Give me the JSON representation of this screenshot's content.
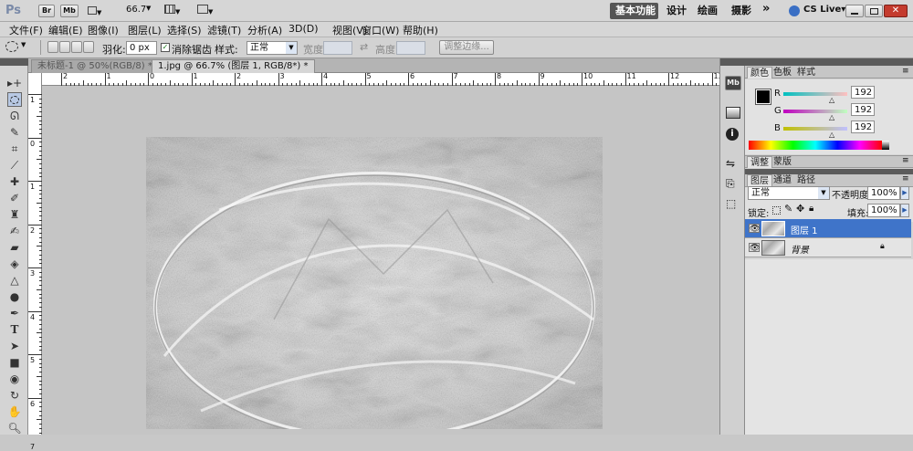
{
  "app": {
    "logo": "Ps",
    "badge_br": "Br",
    "badge_mb": "Mb",
    "zoom": "66.7"
  },
  "workspace": {
    "essentials": "基本功能",
    "design": "设计",
    "painting": "绘画",
    "photography": "摄影",
    "more": "»",
    "cslive": "CS Live▾"
  },
  "menus": [
    "文件(F)",
    "编辑(E)",
    "图像(I)",
    "图层(L)",
    "选择(S)",
    "滤镜(T)",
    "分析(A)",
    "3D(D)",
    "视图(V)",
    "窗口(W)",
    "帮助(H)"
  ],
  "options": {
    "feather_label": "羽化:",
    "feather_value": "0 px",
    "antialias": "消除锯齿",
    "style_label": "样式:",
    "style_value": "正常",
    "width_label": "宽度:",
    "height_label": "高度:",
    "refine": "调整边缘..."
  },
  "doc_tabs": [
    "未标题-1 @ 50%(RGB/8) *",
    "1.jpg @ 66.7% (图层 1, RGB/8*) *"
  ],
  "ruler_h": [
    "2",
    "1",
    "0",
    "1",
    "2",
    "3",
    "4",
    "5",
    "6",
    "7",
    "8",
    "9",
    "10",
    "11",
    "12",
    "13"
  ],
  "ruler_v": [
    "1",
    "0",
    "1",
    "2",
    "3",
    "4",
    "5",
    "6",
    "7"
  ],
  "color_panel": {
    "tabs": [
      "颜色",
      "色板",
      "样式"
    ],
    "r_label": "R",
    "g_label": "G",
    "b_label": "B",
    "r_value": "192",
    "g_value": "192",
    "b_value": "192"
  },
  "adjust_tabs": [
    "调整",
    "蒙版"
  ],
  "layers_panel": {
    "tabs": [
      "图层",
      "通道",
      "路径"
    ],
    "blend_mode": "正常",
    "opacity_label": "不透明度:",
    "opacity_value": "100%",
    "lock_label": "锁定:",
    "fill_label": "填充:",
    "fill_value": "100%",
    "layers": [
      {
        "name": "图层 1",
        "selected": true
      },
      {
        "name": "背景",
        "selected": false
      }
    ]
  },
  "colors": {
    "accent": "#3a6fc4",
    "selected_layer": "#3f74c9",
    "window_red": "#c43b2e"
  }
}
